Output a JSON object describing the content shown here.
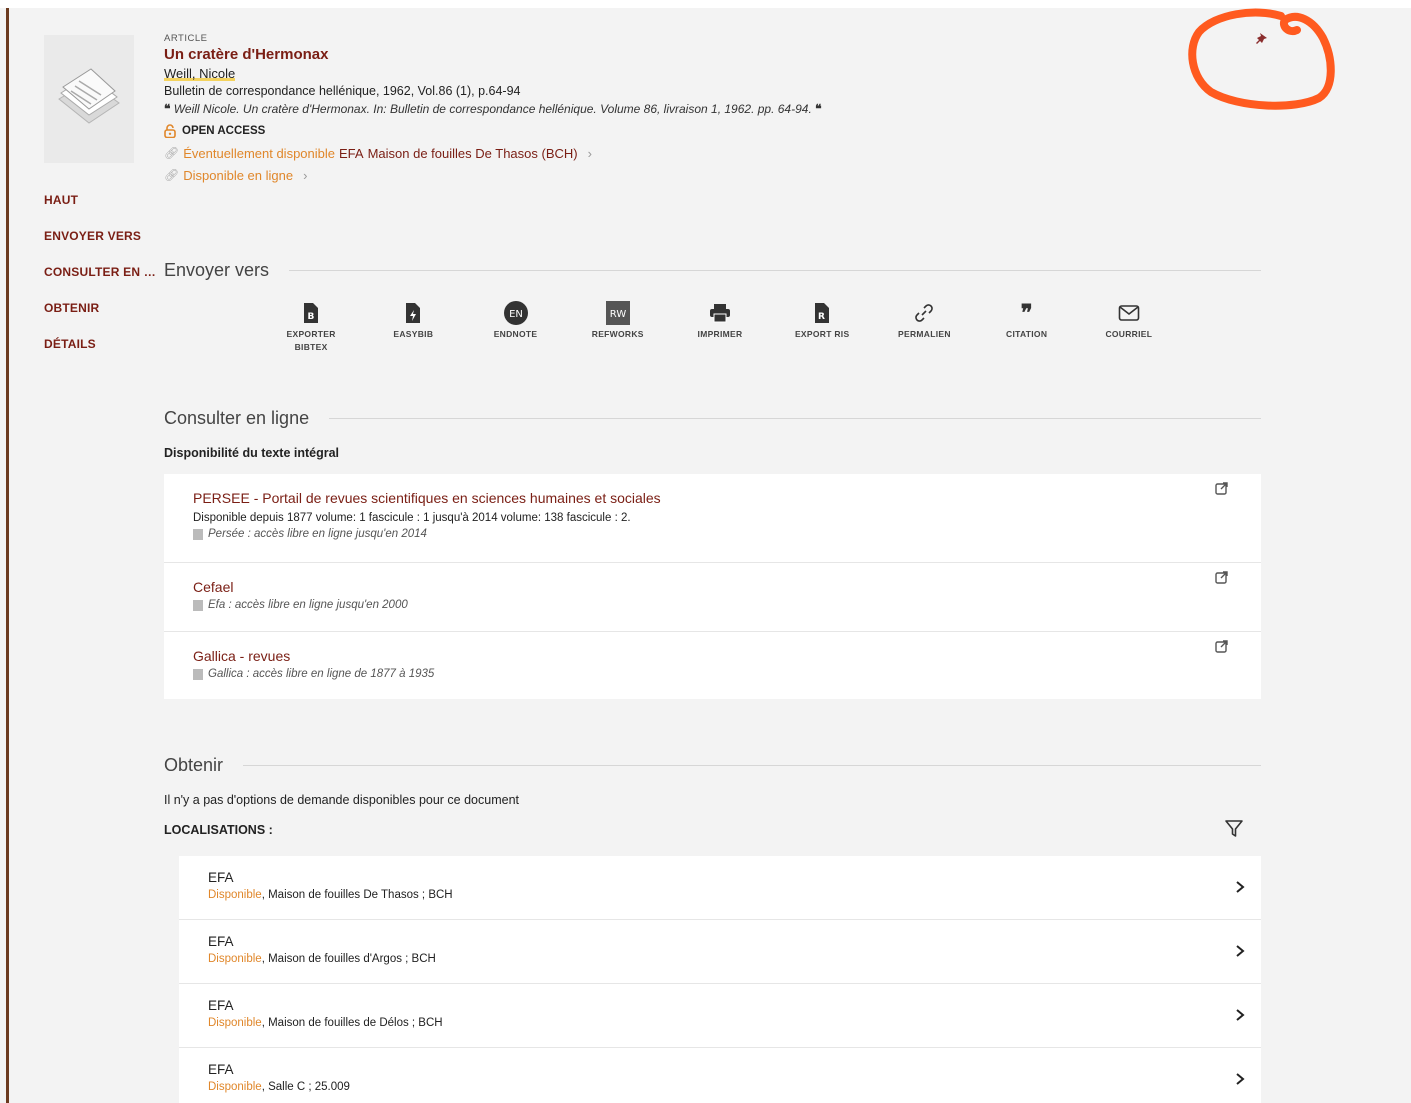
{
  "record": {
    "type": "ARTICLE",
    "title": "Un cratère d'Hermonax",
    "author": "Weill, Nicole",
    "source": "Bulletin de correspondance hellénique, 1962, Vol.86 (1), p.64-94",
    "citation": "Weill Nicole. Un cratère d'Hermonax. In: Bulletin de correspondance hellénique. Volume 86, livraison 1, 1962. pp. 64-94.",
    "open_access": "OPEN ACCESS",
    "availability": [
      {
        "status": "Éventuellement disponible",
        "library": "EFA",
        "location": "Maison de fouilles De Thasos (BCH)"
      },
      {
        "status": "Disponible en ligne",
        "library": "",
        "location": ""
      }
    ]
  },
  "leftnav": [
    "HAUT",
    "ENVOYER VERS",
    "CONSULTER EN LIGNE",
    "OBTENIR",
    "DÉTAILS"
  ],
  "sendto": {
    "heading": "Envoyer vers",
    "actions": [
      {
        "label": "EXPORTER BIBTEX",
        "icon": "file-bibtex-icon"
      },
      {
        "label": "EASYBIB",
        "icon": "easybib-icon"
      },
      {
        "label": "ENDNOTE",
        "icon": "endnote-icon",
        "badge": "EN"
      },
      {
        "label": "REFWORKS",
        "icon": "refworks-icon",
        "badge": "RW"
      },
      {
        "label": "IMPRIMER",
        "icon": "print-icon"
      },
      {
        "label": "EXPORT RIS",
        "icon": "export-ris-icon"
      },
      {
        "label": "PERMALIEN",
        "icon": "link-icon"
      },
      {
        "label": "CITATION",
        "icon": "quote-icon",
        "glyph": "❞"
      },
      {
        "label": "COURRIEL",
        "icon": "mail-icon"
      }
    ]
  },
  "online": {
    "heading": "Consulter en ligne",
    "subheading": "Disponibilité du texte intégral",
    "links": [
      {
        "title": "PERSEE - Portail de revues scientifiques en sciences humaines et sociales",
        "desc": "Disponible depuis 1877 volume: 1 fascicule : 1 jusqu'à 2014 volume: 138 fascicule : 2.",
        "note": "Persée : accès libre en ligne jusqu'en 2014"
      },
      {
        "title": "Cefael",
        "desc": "",
        "note": "Efa : accès libre en ligne jusqu'en 2000"
      },
      {
        "title": "Gallica - revues",
        "desc": "",
        "note": "Gallica : accès libre en ligne de 1877 à 1935"
      }
    ]
  },
  "get": {
    "heading": "Obtenir",
    "info": "Il n'y a pas d'options de demande disponibles pour ce document",
    "locations_label": "LOCALISATIONS :",
    "holdings": [
      {
        "library": "EFA",
        "status": "Disponible",
        "location": ", Maison de fouilles De Thasos ; BCH"
      },
      {
        "library": "EFA",
        "status": "Disponible",
        "location": ", Maison de fouilles d'Argos ; BCH"
      },
      {
        "library": "EFA",
        "status": "Disponible",
        "location": ", Maison de fouilles de Délos ; BCH"
      },
      {
        "library": "EFA",
        "status": "Disponible",
        "location": ", Salle C ; 25.009"
      }
    ]
  },
  "colors": {
    "brand": "#7a1e14",
    "accent": "#e0872b",
    "annotation": "#ff5a1f"
  }
}
